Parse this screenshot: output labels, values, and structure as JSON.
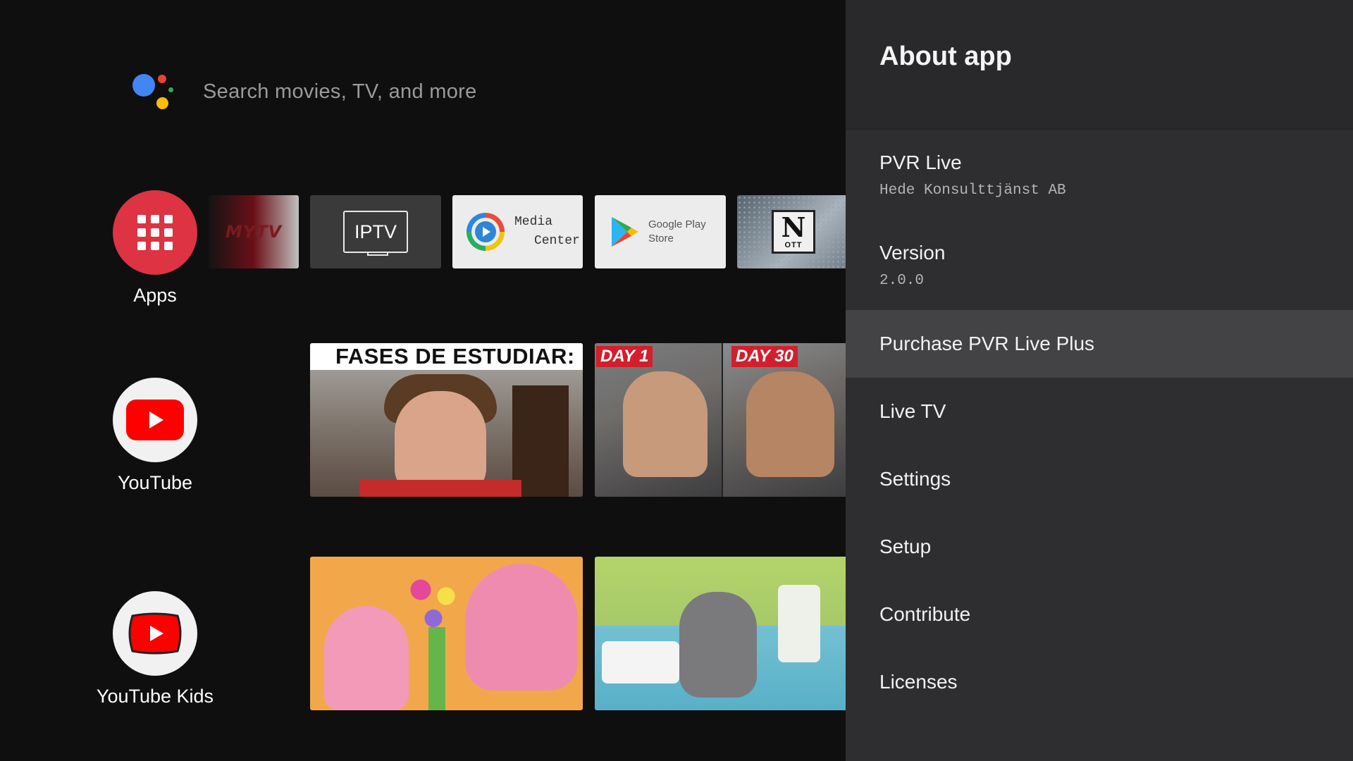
{
  "home": {
    "search": {
      "placeholder": "Search movies, TV, and more",
      "icon": "google-assistant-icon"
    },
    "assistant_colors": {
      "blue": "#4285F4",
      "red": "#EA4335",
      "yellow": "#FBBC05",
      "green": "#34A853"
    },
    "launchers": {
      "apps": {
        "label": "Apps",
        "color": "#dd3343"
      },
      "youtube": {
        "label": "YouTube",
        "color": "#ff0000"
      },
      "youtube_kids": {
        "label": "YouTube Kids",
        "color": "#ff0000"
      }
    },
    "app_tiles": {
      "mytv": "MYTV",
      "iptv": "IPTV",
      "media_center": {
        "line1": "Media",
        "line2": "Center"
      },
      "google_play": {
        "line1": "Google Play",
        "line2": "Store"
      },
      "ott": {
        "logo": "N",
        "text": "OTT"
      }
    },
    "youtube_videos": {
      "video1_caption": "FASES DE ESTUDIAR:",
      "video2_tag_left": "DAY 1",
      "video2_tag_right": "DAY 30"
    }
  },
  "panel": {
    "title": "About app",
    "app_name": "PVR Live",
    "developer": "Hede Konsulttjänst AB",
    "version_label": "Version",
    "version_value": "2.0.0",
    "menu": [
      {
        "label": "Purchase PVR Live Plus",
        "selected": true
      },
      {
        "label": "Live TV",
        "selected": false
      },
      {
        "label": "Settings",
        "selected": false
      },
      {
        "label": "Setup",
        "selected": false
      },
      {
        "label": "Contribute",
        "selected": false
      },
      {
        "label": "Licenses",
        "selected": false
      }
    ],
    "colors": {
      "background": "#2e2e30",
      "header": "#29292b",
      "selected": "#434345"
    }
  }
}
